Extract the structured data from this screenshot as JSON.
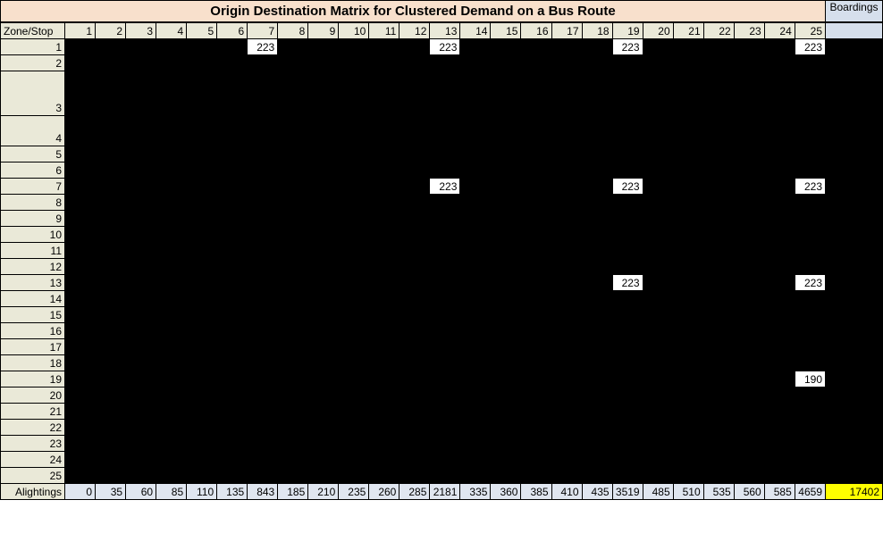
{
  "title": "Origin Destination Matrix for Clustered Demand on a Bus Route",
  "corner_label": "Zone/Stop",
  "boardings_label": "Boardings",
  "alightings_label": "Alightings",
  "col_headers": [
    "1",
    "2",
    "3",
    "4",
    "5",
    "6",
    "7",
    "8",
    "9",
    "10",
    "11",
    "12",
    "13",
    "14",
    "15",
    "16",
    "17",
    "18",
    "19",
    "20",
    "21",
    "22",
    "23",
    "24",
    "25"
  ],
  "row_headers": [
    "1",
    "2",
    "3",
    "4",
    "5",
    "6",
    "7",
    "8",
    "9",
    "10",
    "11",
    "12",
    "13",
    "14",
    "15",
    "16",
    "17",
    "18",
    "19",
    "20",
    "21",
    "22",
    "23",
    "24",
    "25"
  ],
  "cells": {
    "1": {
      "7": "223",
      "13": "223",
      "19": "223",
      "25": "223"
    },
    "7": {
      "13": "223",
      "19": "223",
      "25": "223"
    },
    "13": {
      "19": "223",
      "25": "223"
    },
    "19": {
      "25": "190"
    }
  },
  "alightings": [
    "0",
    "35",
    "60",
    "85",
    "110",
    "135",
    "843",
    "185",
    "210",
    "235",
    "260",
    "285",
    "2181",
    "335",
    "360",
    "385",
    "410",
    "435",
    "3519",
    "485",
    "510",
    "535",
    "560",
    "585",
    "4659"
  ],
  "boardings_total": "17402",
  "chart_data": {
    "type": "table",
    "title": "Origin Destination Matrix for Clustered Demand on a Bus Route",
    "row_axis": "Zone/Stop (origin)",
    "col_axis": "Zone/Stop (destination)",
    "visible_od_values": [
      {
        "origin": 1,
        "destination": 7,
        "value": 223
      },
      {
        "origin": 1,
        "destination": 13,
        "value": 223
      },
      {
        "origin": 1,
        "destination": 19,
        "value": 223
      },
      {
        "origin": 1,
        "destination": 25,
        "value": 223
      },
      {
        "origin": 7,
        "destination": 13,
        "value": 223
      },
      {
        "origin": 7,
        "destination": 19,
        "value": 223
      },
      {
        "origin": 7,
        "destination": 25,
        "value": 223
      },
      {
        "origin": 13,
        "destination": 19,
        "value": 223
      },
      {
        "origin": 13,
        "destination": 25,
        "value": 223
      },
      {
        "origin": 19,
        "destination": 25,
        "value": 190
      }
    ],
    "alightings_by_stop": {
      "1": 0,
      "2": 35,
      "3": 60,
      "4": 85,
      "5": 110,
      "6": 135,
      "7": 843,
      "8": 185,
      "9": 210,
      "10": 235,
      "11": 260,
      "12": 285,
      "13": 2181,
      "14": 335,
      "15": 360,
      "16": 385,
      "17": 410,
      "18": 435,
      "19": 3519,
      "20": 485,
      "21": 510,
      "22": 535,
      "23": 560,
      "24": 585,
      "25": 4659
    },
    "grand_total_boardings": 17402
  }
}
